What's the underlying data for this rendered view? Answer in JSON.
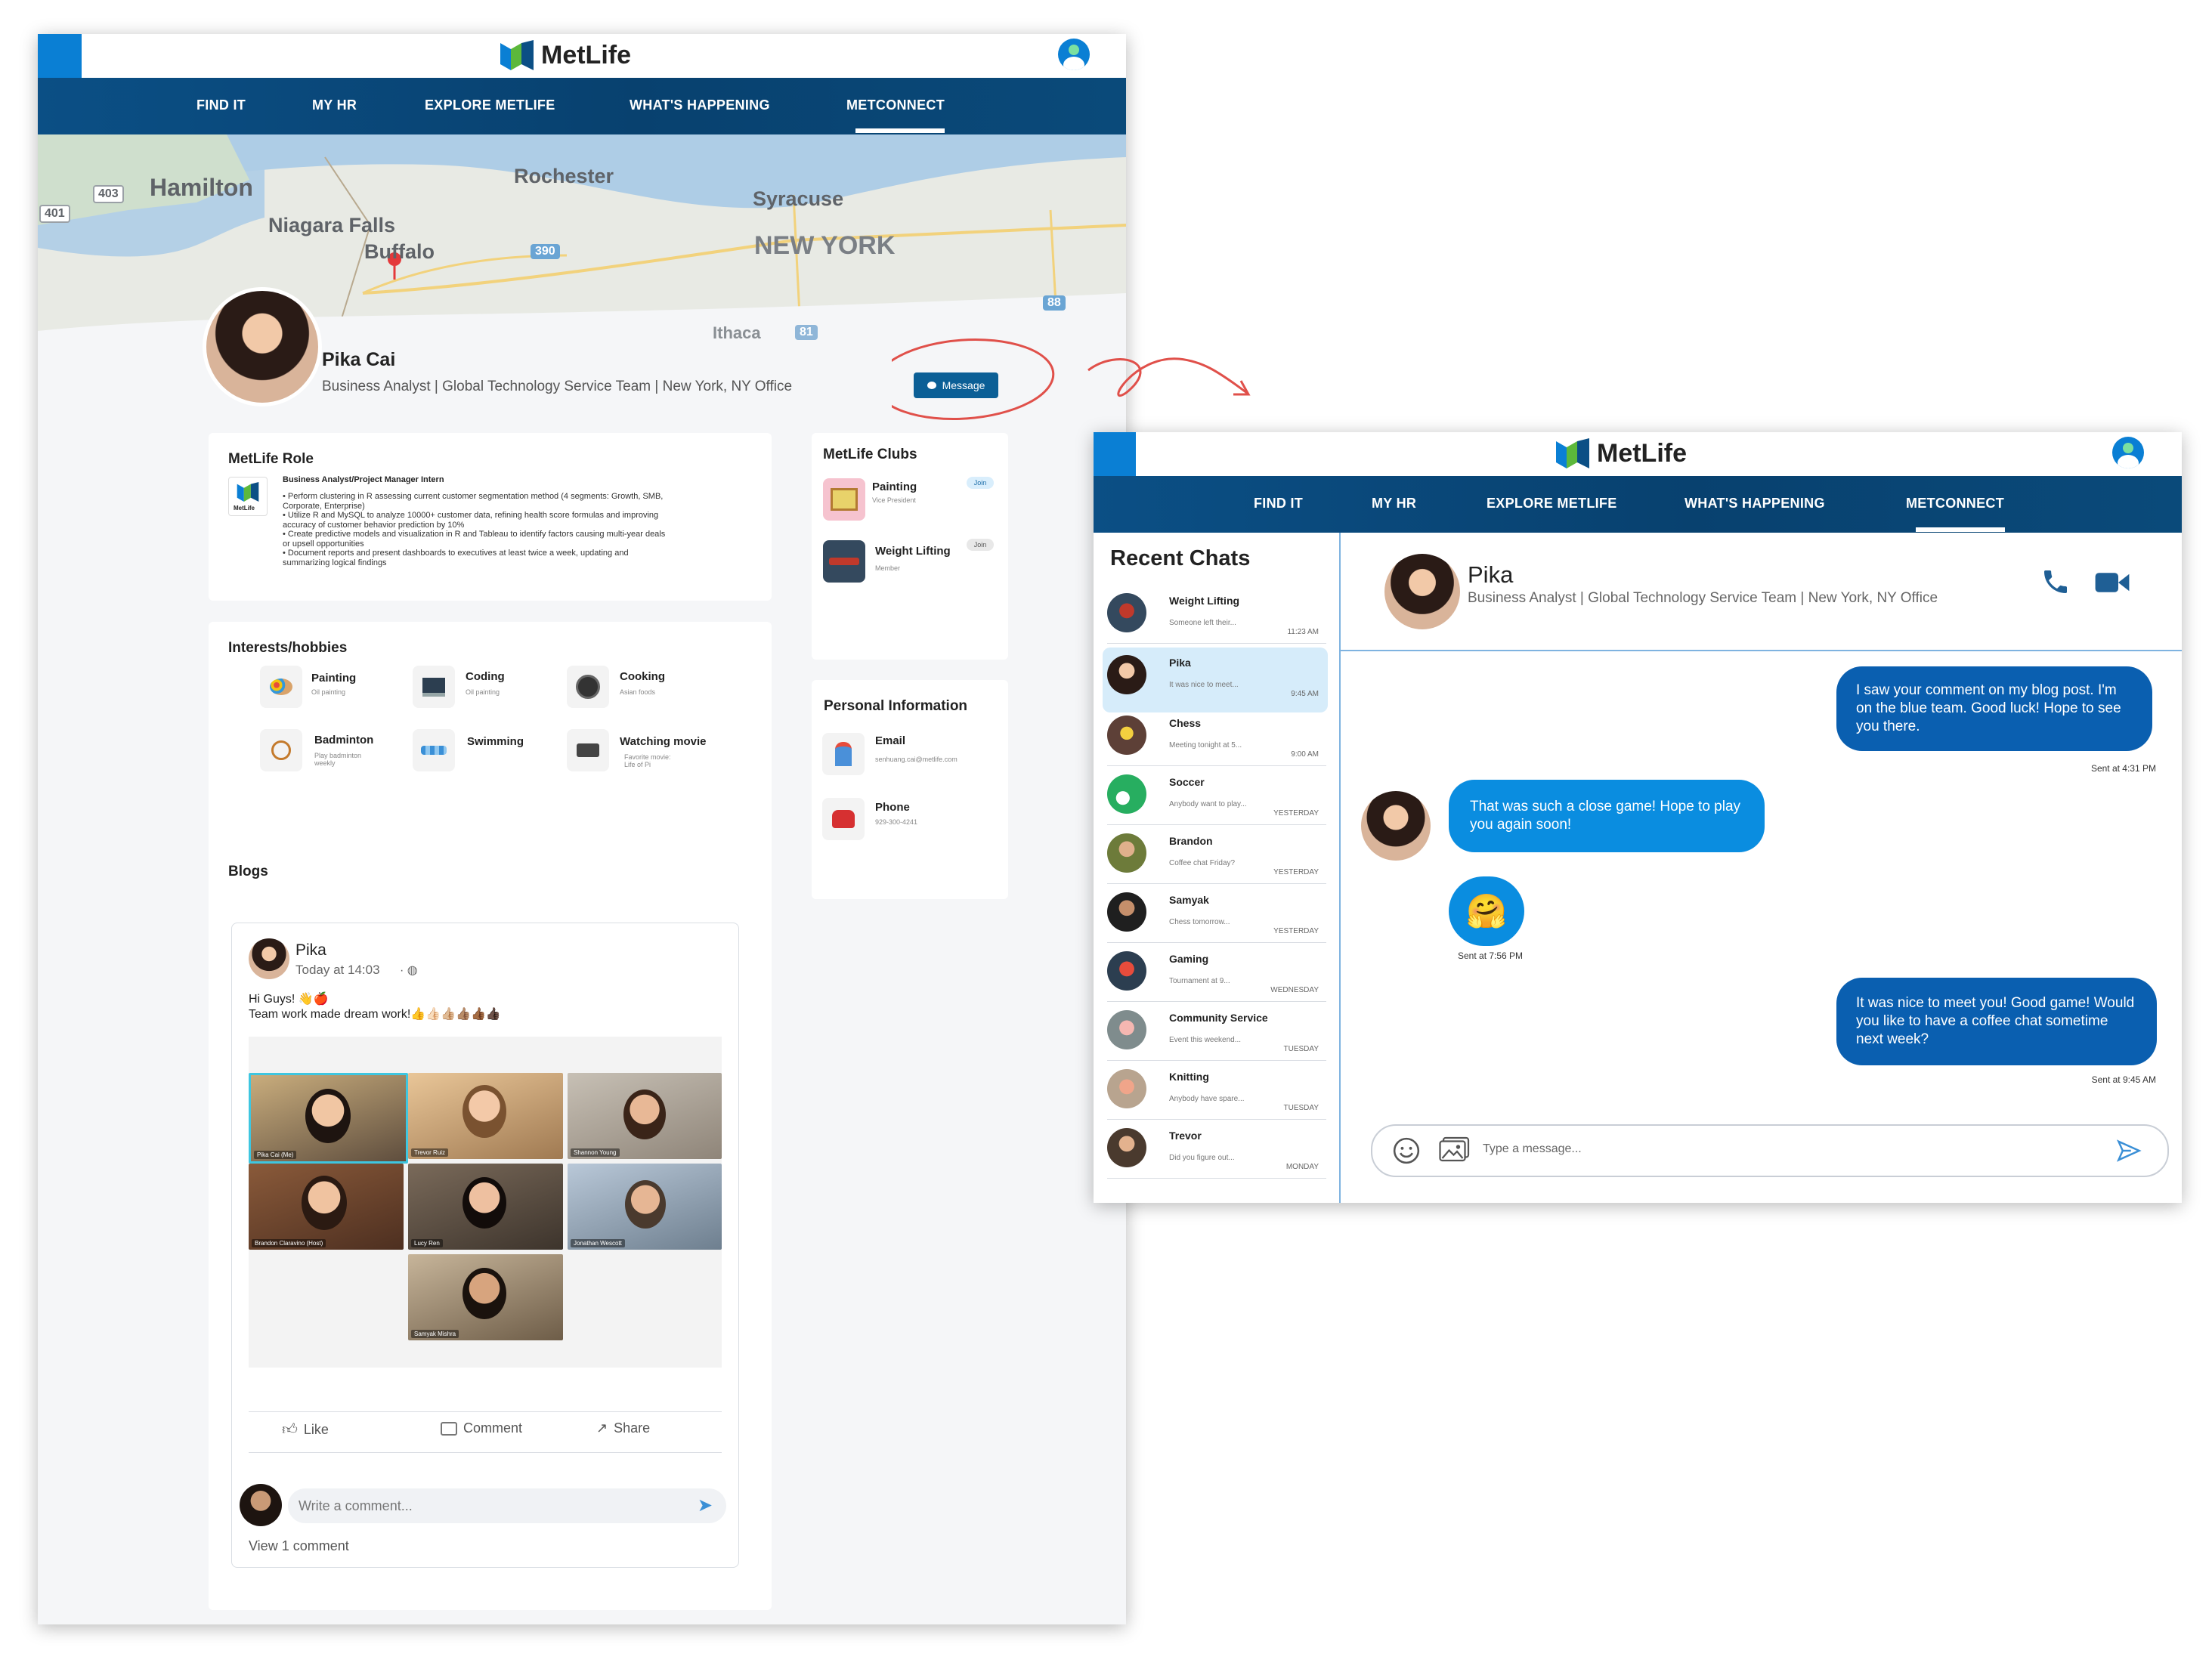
{
  "brand": {
    "name": "MetLife"
  },
  "nav": {
    "items": [
      "FIND IT",
      "MY HR",
      "EXPLORE METLIFE",
      "WHAT'S HAPPENING",
      "METCONNECT"
    ],
    "active": "METCONNECT"
  },
  "map": {
    "labels": [
      "Hamilton",
      "Niagara Falls",
      "Buffalo",
      "Rochester",
      "Syracuse",
      "NEW YORK",
      "Ithaca",
      "401",
      "403",
      "390",
      "88",
      "81"
    ]
  },
  "profile": {
    "name": "Pika Cai",
    "subtitle": "Business Analyst | Global Technology Service Team | New York, NY Office",
    "message_label": "Message"
  },
  "role": {
    "title": "MetLife Role",
    "logo_text": "MetLife",
    "position": "Business Analyst/Project Manager Intern",
    "bullets": [
      "• Perform clustering in R assessing current customer segmentation method (4 segments: Growth, SMB,",
      "Corporate, Enterprise)",
      "• Utilize R and MySQL to analyze 10000+ customer data, refining health score formulas and improving",
      "accuracy of customer behavior prediction by 10%",
      "• Create predictive models and visualization in R and Tableau to identify factors causing multi-year deals",
      "or upsell opportunities",
      "• Document reports and present dashboards to executives at least twice a week, updating and",
      "summarizing logical findings"
    ]
  },
  "clubs": {
    "title": "MetLife Clubs",
    "items": [
      {
        "name": "Painting",
        "role": "Vice President",
        "action": "Join"
      },
      {
        "name": "Weight Lifting",
        "role": "Member",
        "action": "Join"
      }
    ]
  },
  "interests": {
    "title": "Interests/hobbies",
    "items": [
      {
        "name": "Painting",
        "detail": "Oil painting",
        "detail2": ""
      },
      {
        "name": "Coding",
        "detail": "Oil painting",
        "detail2": ""
      },
      {
        "name": "Cooking",
        "detail": "Asian foods",
        "detail2": ""
      },
      {
        "name": "Badminton",
        "detail": "Play badminton",
        "detail2": "weekly"
      },
      {
        "name": "Swimming",
        "detail": "",
        "detail2": ""
      },
      {
        "name": "Watching movie",
        "detail": "Favorite movie:",
        "detail2": "Life of Pi"
      }
    ]
  },
  "personal": {
    "title": "Personal Information",
    "email_label": "Email",
    "email": "senhuang.cai@metlife.com",
    "phone_label": "Phone",
    "phone": "929-300-4241"
  },
  "blogs": {
    "title": "Blogs",
    "post": {
      "author": "Pika",
      "time": "Today at 14:03",
      "line1": "Hi Guys! 👋🍎",
      "line2": "Team work made dream work!👍👍🏻👍🏼👍🏽👍🏾👍🏿",
      "participants": [
        "Pika Cai (Me)",
        "Trevor Ruiz",
        "Shannon Young",
        "Brandon Claravino (Host)",
        "Lucy Ren",
        "Jonathan Wescott",
        "Samyak Mishra"
      ],
      "like": "Like",
      "comment": "Comment",
      "share": "Share",
      "comment_placeholder": "Write a comment...",
      "view_comments": "View 1 comment"
    }
  },
  "chat": {
    "sidebar_title": "Recent Chats",
    "list": [
      {
        "name": "Weight Lifting",
        "preview": "Someone left their...",
        "time": "11:23 AM"
      },
      {
        "name": "Pika",
        "preview": "It was nice to meet...",
        "time": "9:45 AM"
      },
      {
        "name": "Chess",
        "preview": "Meeting tonight at 5...",
        "time": "9:00 AM"
      },
      {
        "name": "Soccer",
        "preview": "Anybody want to play...",
        "time": "YESTERDAY"
      },
      {
        "name": "Brandon",
        "preview": "Coffee chat Friday?",
        "time": "YESTERDAY"
      },
      {
        "name": "Samyak",
        "preview": "Chess tomorrow...",
        "time": "YESTERDAY"
      },
      {
        "name": "Gaming",
        "preview": "Tournament at 9...",
        "time": "WEDNESDAY"
      },
      {
        "name": "Community Service",
        "preview": "Event this weekend...",
        "time": "TUESDAY"
      },
      {
        "name": "Knitting",
        "preview": "Anybody have spare...",
        "time": "TUESDAY"
      },
      {
        "name": "Trevor",
        "preview": "Did you figure out...",
        "time": "MONDAY"
      }
    ],
    "header_name": "Pika",
    "header_subtitle": "Business Analyst | Global Technology Service Team | New York, NY Office",
    "messages": [
      {
        "text": "I saw your comment on my blog post. I'm on the blue team. Good luck! Hope to see you there.",
        "stamp": "Sent at 4:31 PM"
      },
      {
        "text": "That was such a close game! Hope to play you again soon!",
        "stamp": ""
      },
      {
        "text": "🤗",
        "stamp": "Sent at 7:56 PM"
      },
      {
        "text": "It was nice to meet you! Good game! Would you like to have a coffee chat sometime next week?",
        "stamp": "Sent at 9:45 AM"
      }
    ],
    "input_placeholder": "Type a message..."
  },
  "colors": {
    "brand_blue": "#0a7fd4",
    "nav_navy": "#0b4f85",
    "bubble_blue": "#0a5fb0",
    "incoming_blue": "#0a8de0",
    "annotation_red": "#e0504a"
  }
}
